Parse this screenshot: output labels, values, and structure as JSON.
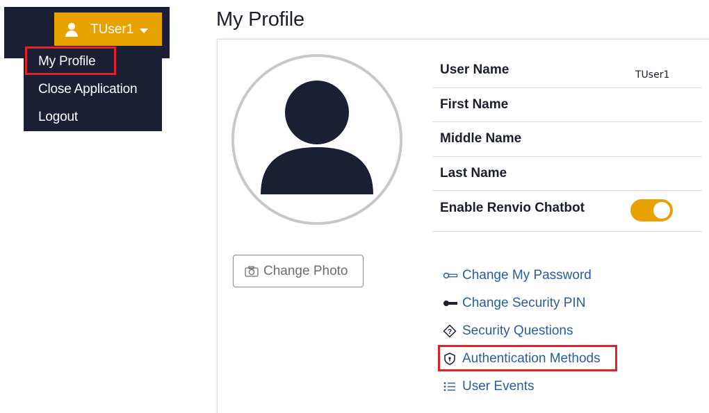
{
  "user_menu": {
    "username": "TUser1",
    "items": [
      {
        "label": "My Profile"
      },
      {
        "label": "Close Application"
      },
      {
        "label": "Logout"
      }
    ]
  },
  "page": {
    "title": "My Profile"
  },
  "profile": {
    "change_photo_label": "Change Photo",
    "fields": [
      {
        "label": "User Name",
        "value": "TUser1"
      },
      {
        "label": "First Name",
        "value": ""
      },
      {
        "label": "Middle Name",
        "value": ""
      },
      {
        "label": "Last Name",
        "value": ""
      }
    ],
    "chatbot": {
      "label": "Enable Renvio Chatbot",
      "enabled": true
    }
  },
  "links": [
    {
      "label": "Change My Password",
      "icon": "key-outline-icon"
    },
    {
      "label": "Change Security PIN",
      "icon": "key-solid-icon"
    },
    {
      "label": "Security Questions",
      "icon": "question-diamond-icon"
    },
    {
      "label": "Authentication Methods",
      "icon": "shield-icon"
    },
    {
      "label": "User Events",
      "icon": "list-icon"
    }
  ],
  "colors": {
    "accent": "#e8a200",
    "navy": "#1b1f33",
    "link": "#2b5d97",
    "highlight": "#e0202b"
  }
}
